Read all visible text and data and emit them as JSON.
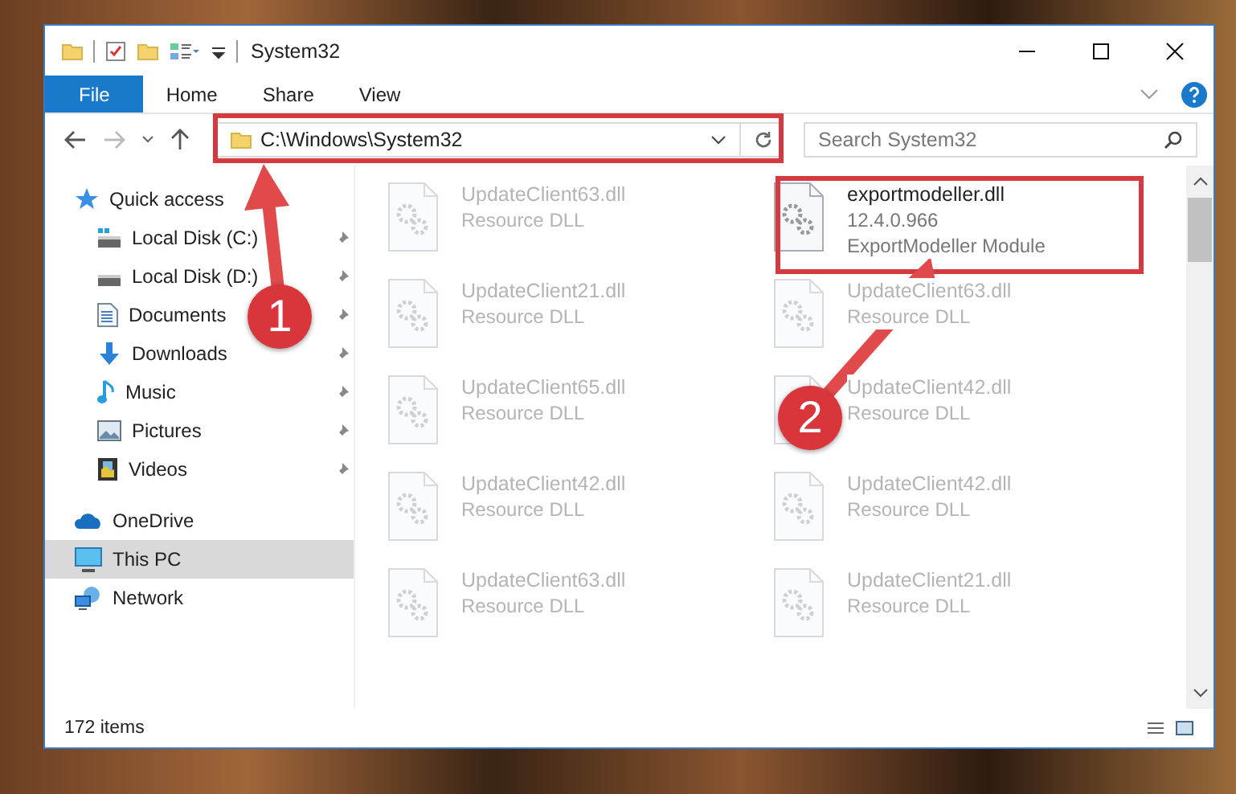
{
  "window": {
    "title": "System32"
  },
  "ribbon_tabs": [
    {
      "label": "File",
      "selected": true
    },
    {
      "label": "Home",
      "selected": false
    },
    {
      "label": "Share",
      "selected": false
    },
    {
      "label": "View",
      "selected": false
    }
  ],
  "address": {
    "path": "C:\\Windows\\System32"
  },
  "search": {
    "placeholder": "Search System32"
  },
  "sidebar": {
    "items": [
      {
        "label": "Quick access",
        "kind": "star",
        "selected": false,
        "children": [
          {
            "label": "Local Disk (C:)",
            "kind": "system-drive",
            "pinned": true
          },
          {
            "label": "Local Disk (D:)",
            "kind": "drive",
            "pinned": true
          },
          {
            "label": "Documents",
            "kind": "document",
            "pinned": true
          },
          {
            "label": "Downloads",
            "kind": "download",
            "pinned": true
          },
          {
            "label": "Music",
            "kind": "music",
            "pinned": true
          },
          {
            "label": "Pictures",
            "kind": "picture",
            "pinned": true
          },
          {
            "label": "Videos",
            "kind": "video",
            "pinned": true
          }
        ]
      },
      {
        "label": "OneDrive",
        "kind": "cloud",
        "selected": false
      },
      {
        "label": "This PC",
        "kind": "computer",
        "selected": true
      },
      {
        "label": "Network",
        "kind": "network",
        "selected": false
      }
    ]
  },
  "files": [
    {
      "name": "UpdateClient63.dll",
      "details": [
        "Resource DLL"
      ],
      "faded": true
    },
    {
      "name": "exportmodeller.dll",
      "details": [
        "12.4.0.966",
        "ExportModeller Module"
      ],
      "faded": false
    },
    {
      "name": "UpdateClient21.dll",
      "details": [
        "Resource DLL"
      ],
      "faded": true
    },
    {
      "name": "UpdateClient63.dll",
      "details": [
        "Resource DLL"
      ],
      "faded": true
    },
    {
      "name": "UpdateClient65.dll",
      "details": [
        "Resource DLL"
      ],
      "faded": true
    },
    {
      "name": "UpdateClient42.dll",
      "details": [
        "Resource DLL"
      ],
      "faded": true
    },
    {
      "name": "UpdateClient42.dll",
      "details": [
        "Resource DLL"
      ],
      "faded": true
    },
    {
      "name": "UpdateClient42.dll",
      "details": [
        "Resource DLL"
      ],
      "faded": true
    },
    {
      "name": "UpdateClient63.dll",
      "details": [
        "Resource DLL"
      ],
      "faded": true
    },
    {
      "name": "UpdateClient21.dll",
      "details": [
        "Resource DLL"
      ],
      "faded": true
    }
  ],
  "annotations": [
    {
      "number": "1"
    },
    {
      "number": "2"
    }
  ],
  "status_bar": {
    "item_count": "172 items"
  }
}
